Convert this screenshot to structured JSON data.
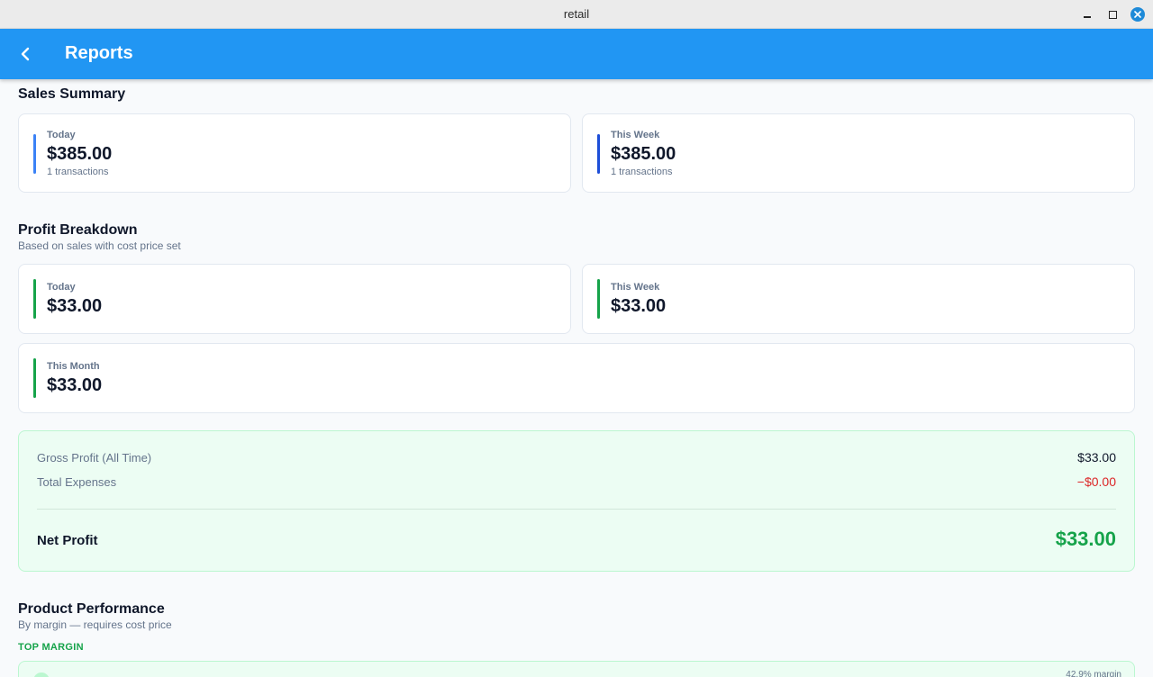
{
  "window": {
    "title": "retail"
  },
  "appbar": {
    "title": "Reports"
  },
  "sales_summary": {
    "heading": "Sales Summary",
    "today": {
      "label": "Today",
      "value": "$385.00",
      "sub": "1 transactions"
    },
    "week": {
      "label": "This Week",
      "value": "$385.00",
      "sub": "1 transactions"
    }
  },
  "profit": {
    "heading": "Profit Breakdown",
    "subheading": "Based on sales with cost price set",
    "today": {
      "label": "Today",
      "value": "$33.00"
    },
    "week": {
      "label": "This Week",
      "value": "$33.00"
    },
    "month": {
      "label": "This Month",
      "value": "$33.00"
    }
  },
  "summary": {
    "gross_label": "Gross Profit (All Time)",
    "gross_value": "$33.00",
    "expenses_label": "Total Expenses",
    "expenses_value": "−$0.00",
    "net_label": "Net Profit",
    "net_value": "$33.00"
  },
  "performance": {
    "heading": "Product Performance",
    "subheading": "By margin — requires cost price",
    "top_label": "TOP MARGIN",
    "first_margin": "42.9% margin"
  },
  "colors": {
    "appbar": "#2196f3",
    "sales_bar_today": "#3b82f6",
    "sales_bar_week": "#1d4ed8",
    "profit_bar": "#16a34a",
    "negative": "#dc2626",
    "positive": "#16a34a"
  },
  "icons": [
    "back-arrow-icon",
    "minimize-icon",
    "maximize-icon",
    "close-icon"
  ]
}
